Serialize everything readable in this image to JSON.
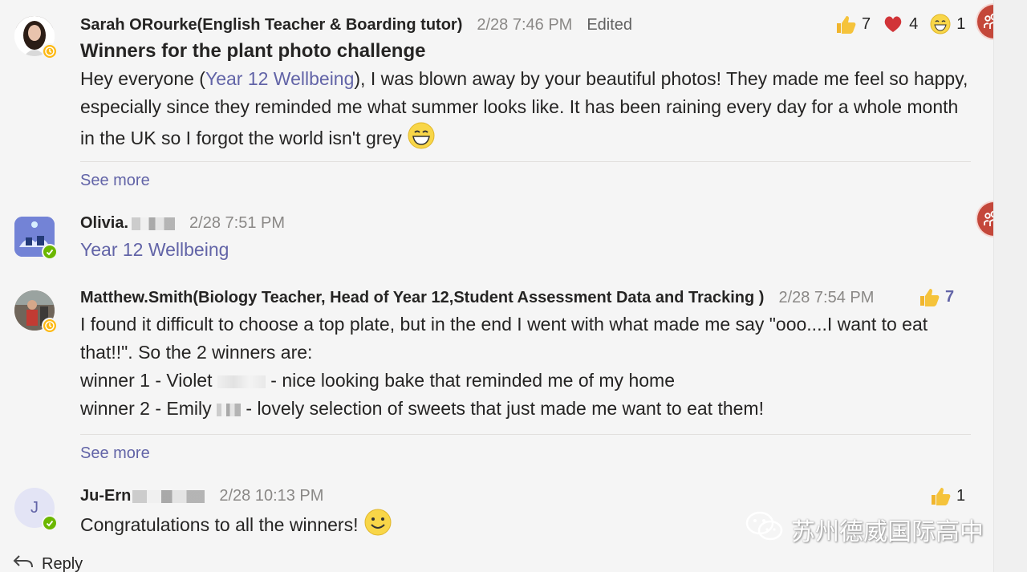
{
  "messages": [
    {
      "author": "Sarah ORourke(English Teacher & Boarding tutor)",
      "timestamp": "2/28 7:46 PM",
      "edited_label": "Edited",
      "subject": "Winners for the plant photo challenge",
      "body_pre": "Hey everyone (",
      "mention": "Year 12 Wellbeing",
      "body_post": "), I was blown away by your beautiful photos! They made me feel so happy, especially since they reminded me what summer looks like. It has been raining every day for a whole month in the UK so I forgot the world isn't grey",
      "see_more": "See more",
      "reactions": [
        {
          "icon": "like-icon",
          "count": "7"
        },
        {
          "icon": "heart-icon",
          "count": "4"
        },
        {
          "icon": "laugh-icon",
          "count": "1"
        }
      ]
    },
    {
      "author": "Olivia.",
      "timestamp": "2/28 7:51 PM",
      "body": "Year 12 Wellbeing"
    },
    {
      "author": "Matthew.Smith(Biology Teacher, Head of Year 12,Student Assessment Data and Tracking )",
      "timestamp": "2/28 7:54 PM",
      "body_line1": "I found it difficult to choose a top plate, but in the end I went with what made me say \"ooo....I want to eat that!!\". So the 2 winners are:",
      "winner1_pre": "winner 1 - Violet",
      "winner1_post": "- nice looking bake that reminded me of my home",
      "winner2_pre": "winner 2 - Emily",
      "winner2_post": "- lovely selection of sweets that just made me want to eat them!",
      "see_more": "See more",
      "reactions": [
        {
          "icon": "like-icon",
          "count": "7"
        }
      ]
    },
    {
      "author": "Ju-Ern",
      "avatar_initial": "J",
      "timestamp": "2/28 10:13 PM",
      "body": "Congratulations to all the winners!",
      "reactions": [
        {
          "icon": "like-icon",
          "count": "1"
        }
      ]
    }
  ],
  "reply_label": "Reply",
  "watermark": "苏州德威国际高中",
  "colors": {
    "accent": "#6264a7",
    "team_badge": "#c4473a",
    "away": "#fdb913",
    "available": "#6bb700"
  }
}
